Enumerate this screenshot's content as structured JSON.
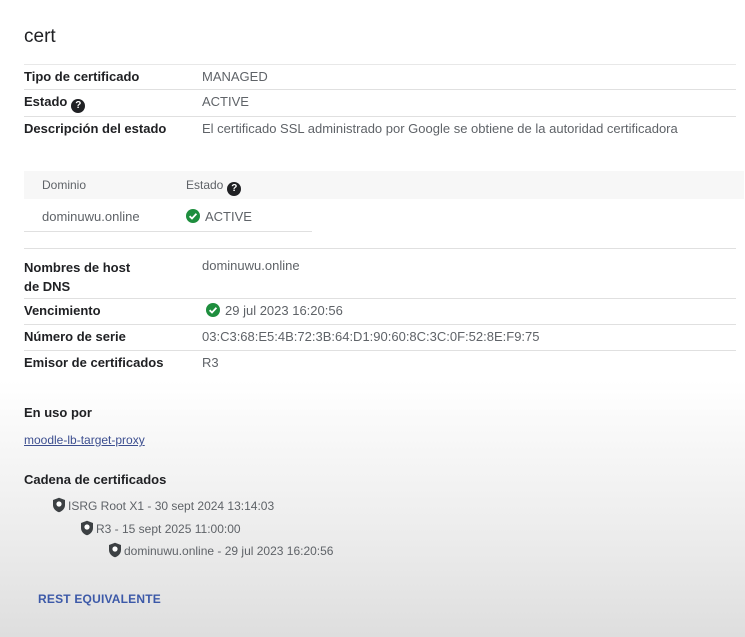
{
  "title": "cert",
  "details": [
    {
      "label": "Tipo de certificado",
      "value": "MANAGED",
      "help": false
    },
    {
      "label": "Estado",
      "value": "ACTIVE",
      "help": true
    },
    {
      "label": "Descripción del estado",
      "value": "El certificado SSL administrado por Google se obtiene de la autoridad certificadora",
      "help": false
    }
  ],
  "domain_table": {
    "headers": [
      "Dominio",
      "Estado"
    ],
    "rows": [
      {
        "domain": "dominuwu.online",
        "status": "ACTIVE"
      }
    ]
  },
  "details2": {
    "dns_label_1": "Nombres de host",
    "dns_label_2": "de DNS",
    "dns_value": "dominuwu.online",
    "expiry_label": "Vencimiento",
    "expiry_value": "29 jul 2023 16:20:56",
    "serial_label": "Número de serie",
    "serial_value": "03:C3:68:E5:4B:72:3B:64:D1:90:60:8C:3C:0F:52:8E:F9:75",
    "issuer_label": "Emisor de certificados",
    "issuer_value": "R3"
  },
  "in_use": {
    "label": "En uso por",
    "link": "moodle-lb-target-proxy"
  },
  "chain": {
    "label": "Cadena de certificados",
    "items": [
      "ISRG Root X1 - 30 sept 2024 13:14:03",
      "R3 - 15 sept 2025 11:00:00",
      "dominuwu.online - 29 jul 2023 16:20:56"
    ]
  },
  "rest_button": "REST EQUIVALENTE",
  "colors": {
    "accent": "#3c59a8",
    "success": "#1e8e3e"
  },
  "icons": [
    "help-icon",
    "check-circle-icon",
    "certificate-icon"
  ]
}
